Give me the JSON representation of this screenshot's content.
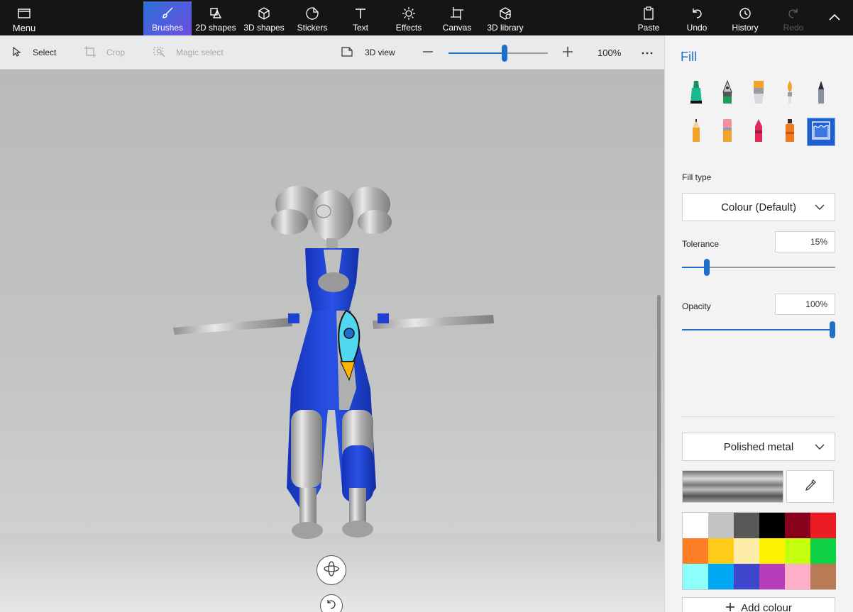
{
  "ribbon": {
    "menu_label": "Menu",
    "brushes_label": "Brushes",
    "shapes2d_label": "2D shapes",
    "shapes3d_label": "3D shapes",
    "stickers_label": "Stickers",
    "text_label": "Text",
    "effects_label": "Effects",
    "canvas_label": "Canvas",
    "library3d_label": "3D library",
    "paste_label": "Paste",
    "undo_label": "Undo",
    "history_label": "History",
    "redo_label": "Redo"
  },
  "toolbar": {
    "select_label": "Select",
    "crop_label": "Crop",
    "magic_select_label": "Magic select",
    "view3d_label": "3D view",
    "zoom_value": "100%",
    "zoom_slider_fraction": 0.57
  },
  "panel": {
    "title": "Fill",
    "brushes": [
      {
        "name": "marker",
        "selected": false
      },
      {
        "name": "calligraphy-pen",
        "selected": false
      },
      {
        "name": "oil-brush",
        "selected": false
      },
      {
        "name": "watercolour",
        "selected": false
      },
      {
        "name": "pixel-pen",
        "selected": false
      },
      {
        "name": "pencil",
        "selected": false
      },
      {
        "name": "eraser",
        "selected": false
      },
      {
        "name": "crayon",
        "selected": false
      },
      {
        "name": "spray-can",
        "selected": false
      },
      {
        "name": "fill",
        "selected": true
      }
    ],
    "fill_type_label": "Fill type",
    "fill_type_value": "Colour (Default)",
    "tolerance_label": "Tolerance",
    "tolerance_value": "15%",
    "tolerance_fraction": 0.15,
    "opacity_label": "Opacity",
    "opacity_value": "100%",
    "opacity_fraction": 1.0,
    "material_value": "Polished metal",
    "add_colour_label": "Add colour",
    "swatches": [
      "#ffffff",
      "#c3c3c3",
      "#585858",
      "#000000",
      "#88001b",
      "#ec1c24",
      "#ff7f27",
      "#ffca18",
      "#fdeca6",
      "#fff200",
      "#c4ff0e",
      "#0ed145",
      "#8cfffb",
      "#00a8f3",
      "#3f48cc",
      "#b83dba",
      "#ffaec8",
      "#b97a56"
    ]
  },
  "colors": {
    "accent": "#1e6fc9",
    "ribbon_bg": "#151515",
    "model_blue": "#1f3fd0",
    "model_silver": "#b8b8b8"
  }
}
